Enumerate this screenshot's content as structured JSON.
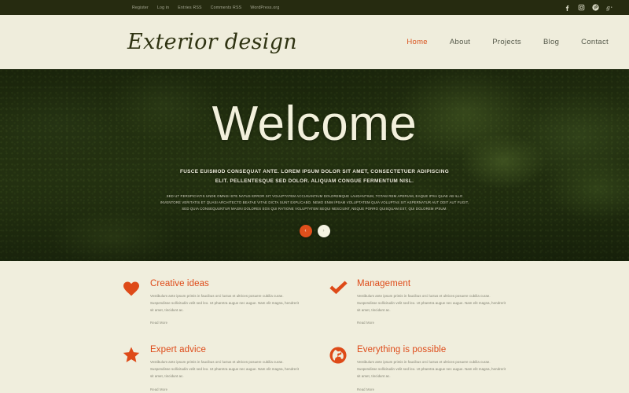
{
  "topbar": {
    "meta_links": [
      {
        "label": "Register"
      },
      {
        "label": "Log in"
      },
      {
        "label": "Entries RSS"
      },
      {
        "label": "Comments RSS"
      },
      {
        "label": "WordPress.org"
      }
    ],
    "social": [
      {
        "name": "facebook-icon",
        "label": "Facebook"
      },
      {
        "name": "instagram-icon",
        "label": "Instagram"
      },
      {
        "name": "pinterest-icon",
        "label": "Pinterest"
      },
      {
        "name": "google-plus-icon",
        "label": "Google Plus"
      }
    ]
  },
  "header": {
    "logo": "Exterior design",
    "nav": [
      {
        "label": "Home",
        "active": true
      },
      {
        "label": "About",
        "active": false
      },
      {
        "label": "Projects",
        "active": false
      },
      {
        "label": "Blog",
        "active": false
      },
      {
        "label": "Contact",
        "active": false
      }
    ]
  },
  "hero": {
    "title": "Welcome",
    "subtitle": "Fusce euismod consequat ante. Lorem ipsum dolor sit amet, consectetuer adipiscing elit. Pellentesque sed dolor. Aliquam congue fermentum nisl.",
    "paragraph": "Sed ut perspiciatis unde omnis iste natus error sit voluptatem accusantium doloremque laudantium, totam rem aperiam, eaque ipsa quae ab illo inventore veritatis et quasi architecto beatae vitae dicta sunt explicabo. Nemo enim ipsam voluptatem quia voluptas sit aspernatur aut odit aut fugit, sed quia consequuntur magni dolores eos qui ratione voluptatem sequi nesciunt, neque porro quisquam est, qui dolorem ipsum.",
    "slider": {
      "prev_label": "‹",
      "next_label": "›"
    }
  },
  "features": {
    "body_text": "Vestibulum ante ipsum primis in faucibus orci luctus et ultrices posuere cubilia curae. Suspendisse sollicitudin velit sed leo. Ut pharetra augue nec augue. Nam elit magna, hendrerit sit amet, tincidunt ac.",
    "read_more_label": "Read More",
    "items": [
      {
        "icon": "heart-icon",
        "title": "Creative ideas"
      },
      {
        "icon": "check-icon",
        "title": "Management"
      },
      {
        "icon": "star-icon",
        "title": "Expert advice"
      },
      {
        "icon": "globe-icon",
        "title": "Everything is possible"
      }
    ]
  },
  "colors": {
    "accent": "#de4a18",
    "topbar_bg": "#262b10",
    "page_bg": "#f0eedd",
    "logo_text": "#2f3312"
  }
}
